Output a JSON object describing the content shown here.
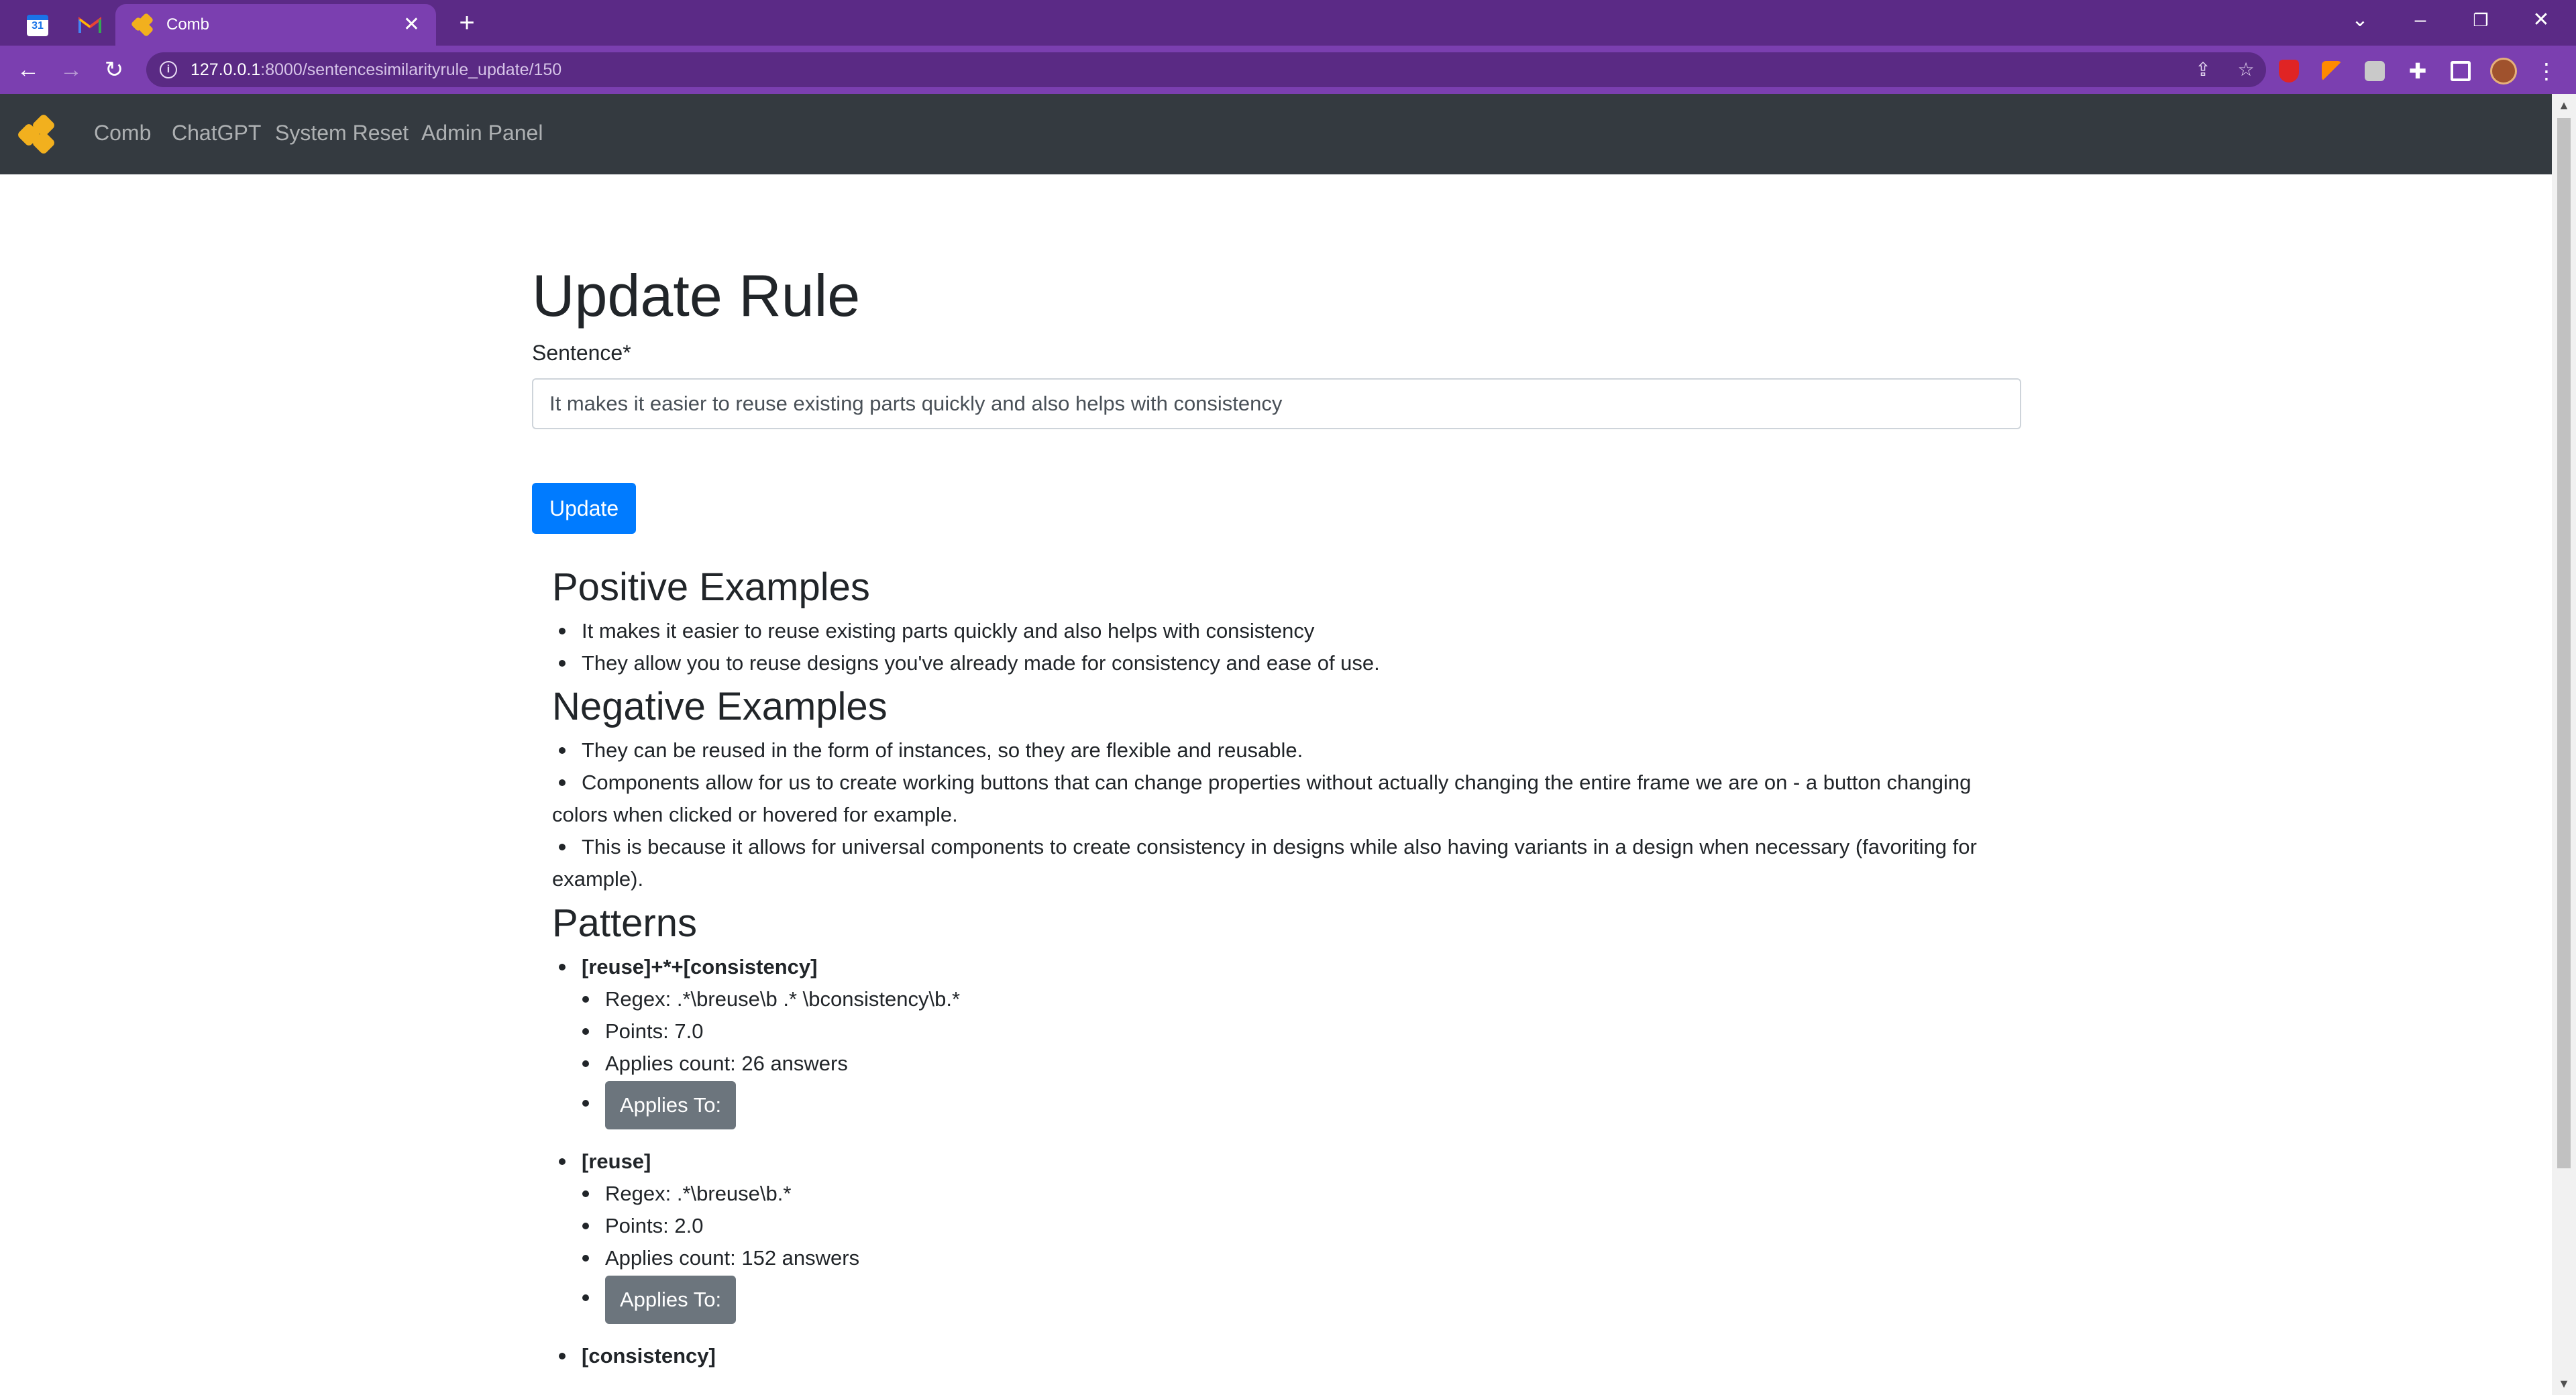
{
  "browser": {
    "tabs": [
      {
        "kind": "favicon",
        "icon": "calendar-icon",
        "label": "31"
      },
      {
        "kind": "favicon",
        "icon": "gmail-icon",
        "label": "M"
      },
      {
        "kind": "active",
        "icon": "honeycomb-icon",
        "title": "Comb"
      }
    ],
    "url_host": "127.0.0.1",
    "url_path": ":8000/sentencesimilarityrule_update/150"
  },
  "navbar": {
    "links": [
      "Comb",
      "ChatGPT",
      "System Reset",
      "Admin Panel"
    ]
  },
  "form": {
    "title": "Update Rule",
    "sentence_label": "Sentence*",
    "sentence_value": "It makes it easier to reuse existing parts quickly and also helps with consistency",
    "submit_label": "Update"
  },
  "positive": {
    "heading": "Positive Examples",
    "items": [
      "It makes it easier to reuse existing parts quickly and also helps with consistency",
      "They allow you to reuse designs you've already made for consistency and ease of use."
    ]
  },
  "negative": {
    "heading": "Negative Examples",
    "items": [
      "They can be reused in the form of instances, so they are flexible and reusable.",
      "Components allow for us to create working buttons that can change properties without actually changing the entire frame we are on - a button changing colors when clicked or hovered for example.",
      "This is because it allows for universal components to create consistency in designs while also having variants in a design when necessary (favoriting for example)."
    ]
  },
  "patterns": {
    "heading": "Patterns",
    "items": [
      {
        "name": "[reuse]+*+[consistency]",
        "regex": "Regex: .*\\breuse\\b .* \\bconsistency\\b.*",
        "points": "Points: 7.0",
        "applies_count": "Applies count: 26 answers",
        "applies_button": "Applies To:"
      },
      {
        "name": "[reuse]",
        "regex": "Regex: .*\\breuse\\b.*",
        "points": "Points: 2.0",
        "applies_count": "Applies count: 152 answers",
        "applies_button": "Applies To:"
      },
      {
        "name": "[consistency]"
      }
    ]
  }
}
